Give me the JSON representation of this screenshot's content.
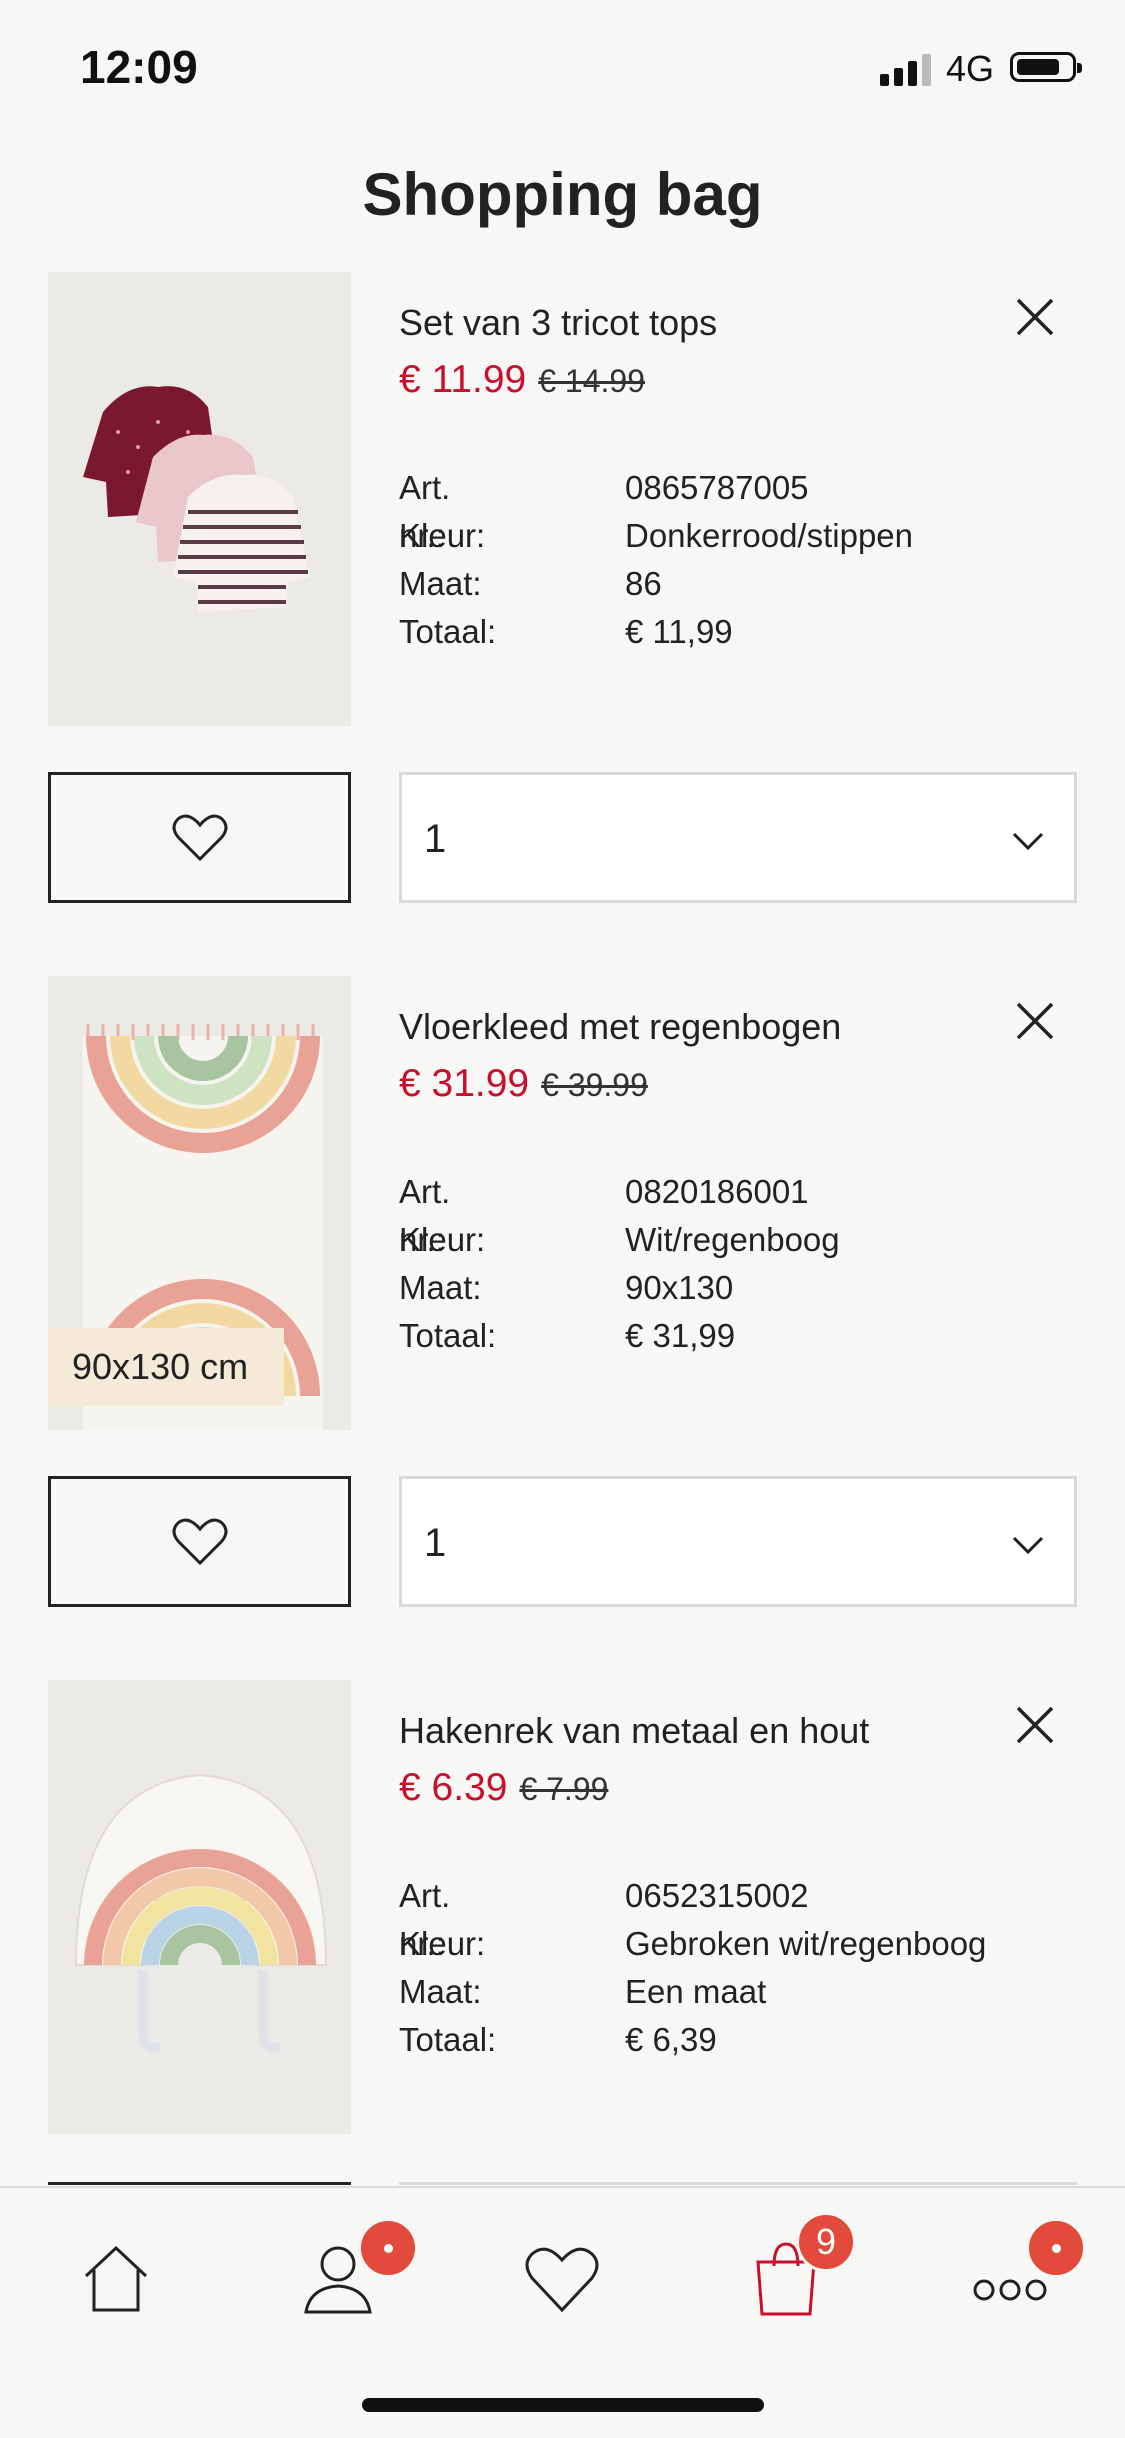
{
  "status_bar": {
    "time": "12:09",
    "network": "4G",
    "battery_level": 0.8
  },
  "page": {
    "title": "Shopping bag"
  },
  "labels": {
    "art": "Art. nr.:",
    "color": "Kleur:",
    "size": "Maat:",
    "total": "Totaal:"
  },
  "items": [
    {
      "name": "Set van 3 tricot tops",
      "price_sale": "€ 11.99",
      "price_original": "€ 14.99",
      "art_nr": "0865787005",
      "color": "Donkerrood/stippen",
      "size": "86",
      "total": "€ 11,99",
      "quantity": "1",
      "image_icon": "tops-photo"
    },
    {
      "name": "Vloerkleed met regenbogen",
      "price_sale": "€ 31.99",
      "price_original": "€ 39.99",
      "art_nr": "0820186001",
      "color": "Wit/regenboog",
      "size": "90x130",
      "total": "€ 31,99",
      "quantity": "1",
      "size_tag": "90x130 cm",
      "image_icon": "rug-photo"
    },
    {
      "name": "Hakenrek van metaal en hout",
      "price_sale": "€ 6.39",
      "price_original": "€ 7.99",
      "art_nr": "0652315002",
      "color": "Gebroken wit/regenboog",
      "size": "Een maat",
      "total": "€ 6,39",
      "image_icon": "hook-rack-photo"
    }
  ],
  "nav": {
    "items": [
      "home-icon",
      "account-icon",
      "favourites-icon",
      "bag-icon",
      "more-icon"
    ],
    "bag_count": "9"
  },
  "colors": {
    "sale": "#c8102e",
    "badge": "#e24b3b",
    "bag_active": "#c8102e"
  }
}
